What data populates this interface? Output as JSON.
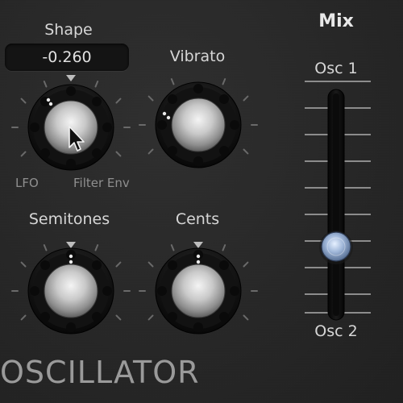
{
  "panel": {
    "module_title": "OSCILLATOR",
    "mix_title": "Mix"
  },
  "knobs": {
    "shape": {
      "label": "Shape",
      "value_display": "-0.260",
      "left_label": "LFO",
      "right_label": "Filter Env"
    },
    "vibrato": {
      "label": "Vibrato"
    },
    "semitones": {
      "label": "Semitones"
    },
    "cents": {
      "label": "Cents"
    }
  },
  "mix_slider": {
    "top_label": "Osc 1",
    "bottom_label": "Osc 2",
    "position_fraction_from_top": 0.7
  },
  "icons": {
    "cursor": "arrow-cursor-icon"
  },
  "colors": {
    "background": "#272727",
    "label_text": "#d6d6d6",
    "value_display_bg": "#141414",
    "slider_thumb": "#9fb6d8"
  }
}
